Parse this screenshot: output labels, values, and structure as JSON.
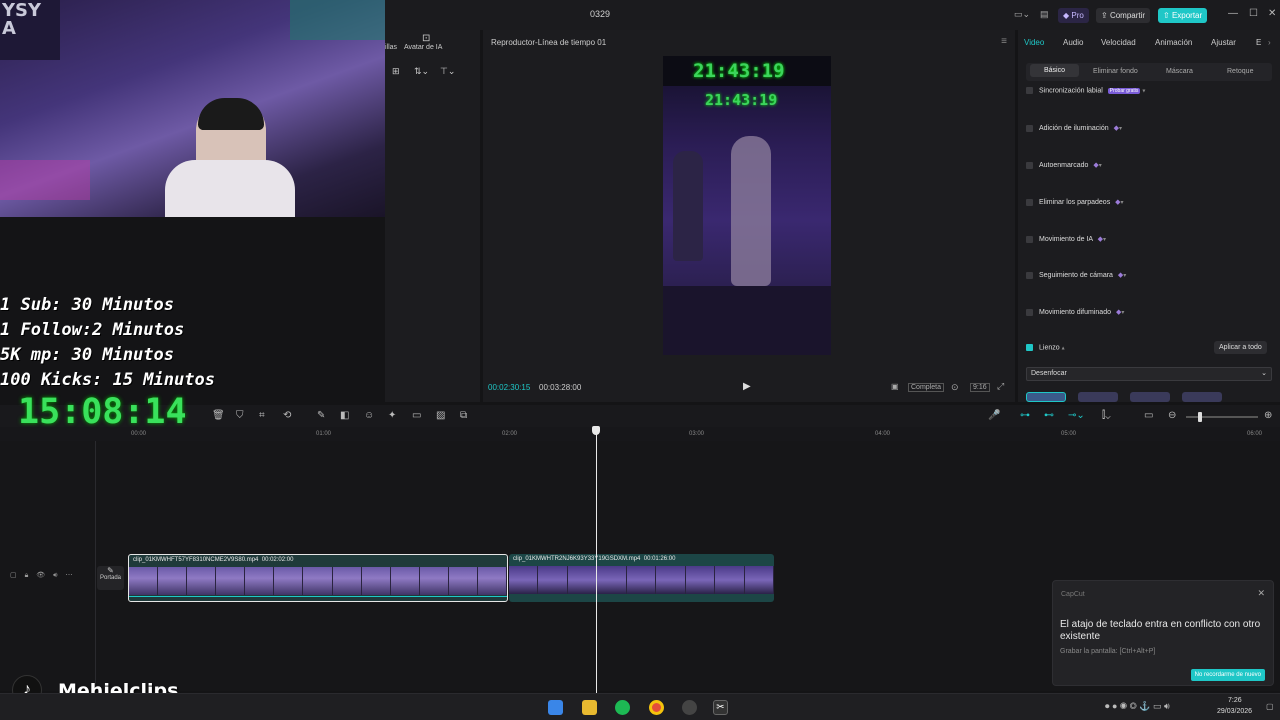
{
  "window": {
    "title": "0329",
    "pro_label": "Pro",
    "share_label": "Compartir",
    "export_label": "Exportar"
  },
  "left_panel": {
    "tab_partial": "illas",
    "tab_avatar": "Avatar de IA"
  },
  "player": {
    "title": "Reproductor-Línea de tiempo 01",
    "time_current": "00:02:30:15",
    "time_total": "00:03:28:00",
    "quality": "Completa",
    "ratio": "9:16",
    "preview_clock_top": "21:43:19",
    "preview_clock_bottom": "21:43:19"
  },
  "right_panel": {
    "tabs": [
      "Video",
      "Audio",
      "Velocidad",
      "Animación",
      "Ajustar",
      "E"
    ],
    "subtabs": [
      "Básico",
      "Eliminar fondo",
      "Máscara",
      "Retoque"
    ],
    "rows": [
      {
        "label": "Sincronización labial",
        "badge": "Probar gratis"
      },
      {
        "label": "Adición de iluminación"
      },
      {
        "label": "Autoenmarcado"
      },
      {
        "label": "Eliminar los parpadeos"
      },
      {
        "label": "Movimiento de IA"
      },
      {
        "label": "Seguimiento de cámara"
      },
      {
        "label": "Movimiento difuminado"
      }
    ],
    "canvas_label": "Lienzo",
    "apply_all": "Aplicar a todo",
    "blur_select": "Desenfocar"
  },
  "timeline": {
    "ruler": [
      "00:00",
      "01:00",
      "02:00",
      "03:00",
      "04:00",
      "05:00",
      "06:00"
    ],
    "cover_label": "Portada",
    "clips": [
      {
        "name": "clip_01KMWHFT57YF8310NCME2V9S80.mp4",
        "duration": "00:02:02:00"
      },
      {
        "name": "clip_01KMWHTR2NJ6K93Y33Y19GSDXM.mp4",
        "duration": "00:01:26:00"
      }
    ]
  },
  "overlay": {
    "line1": "1 Sub: 30 Minutos",
    "line2": "1 Follow:2 Minutos",
    "line3": "5K mp: 30 Minutos",
    "line4": "100 Kicks: 15 Minutos",
    "clock": "15:08:14",
    "watermark": "Mehielclips",
    "webcam_sign": "YSY A"
  },
  "toast": {
    "app": "CapCut",
    "message": "El atajo de teclado entra en conflicto con otro existente",
    "detail": "Grabar la pantalla: [Ctrl+Alt+P]",
    "button": "No recordarme de nuevo"
  },
  "taskbar": {
    "time": "7:26",
    "date": "29/03/2026"
  },
  "colors": {
    "accent": "#1fc7c7",
    "pro": "#6f5cd8",
    "neon_green": "#39e15b"
  }
}
